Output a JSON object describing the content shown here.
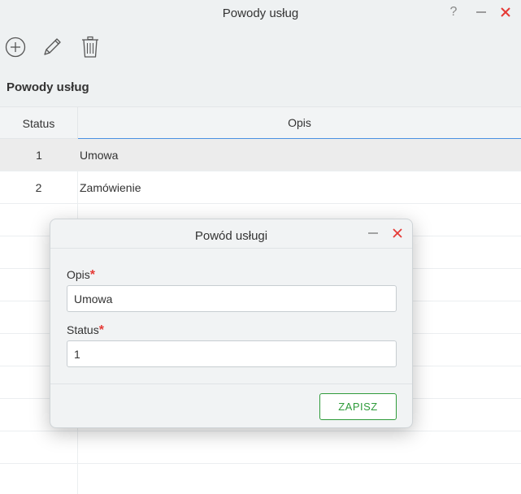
{
  "window": {
    "title": "Powody usług",
    "help_glyph": "?",
    "colors": {
      "close": "#e53935",
      "accent": "#4a90e2"
    }
  },
  "toolbar": {
    "icons": [
      "add-circle-icon",
      "pencil-icon",
      "trash-icon"
    ]
  },
  "section": {
    "label": "Powody usług"
  },
  "table": {
    "columns": [
      "Status",
      "Opis"
    ],
    "rows": [
      {
        "status": "1",
        "opis": "Umowa"
      },
      {
        "status": "2",
        "opis": "Zamówienie"
      }
    ]
  },
  "dialog": {
    "title": "Powód usługi",
    "fields": {
      "opis": {
        "label": "Opis",
        "required_mark": "*",
        "value": "Umowa"
      },
      "status": {
        "label": "Status",
        "required_mark": "*",
        "value": "1"
      }
    },
    "save_label": "ZAPISZ",
    "colors": {
      "save": "#2e9b3a",
      "required": "#e53935"
    }
  }
}
